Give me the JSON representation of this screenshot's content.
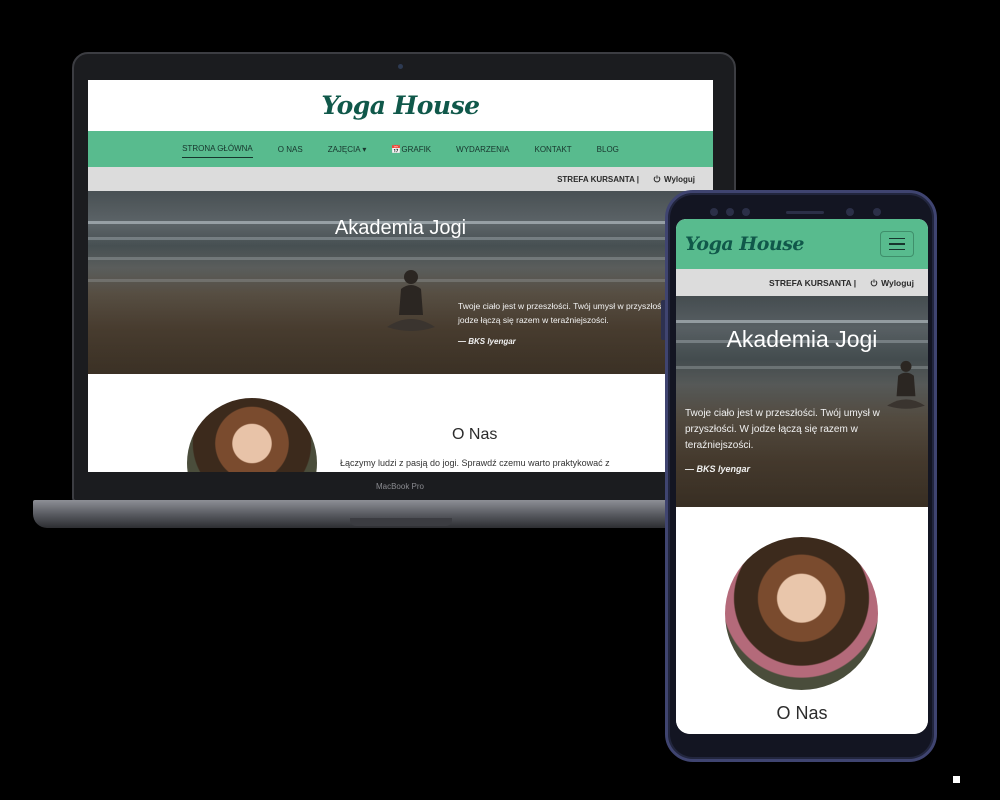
{
  "site": {
    "logo": "Yoga House",
    "nav": [
      "STRONA GŁÓWNA",
      "O NAS",
      "ZAJĘCIA ▾",
      "GRAFIK",
      "WYDARZENIA",
      "KONTAKT",
      "BLOG"
    ],
    "strefa": "STREFA KURSANTA |",
    "logout": "Wyloguj",
    "hero_title": "Akademia Jogi",
    "hero_quote_laptop_line1": "Twoje ciało jest w przeszłości. Twój umysł w przyszłoś",
    "hero_quote_laptop_line2": "jodze łączą się razem w teraźniejszości.",
    "hero_quote_phone": "Twoje ciało jest w przeszłości. Twój umysł w przyszłości. W jodze łączą się razem w teraźniejszości.",
    "hero_author": "— BKS Iyengar",
    "about_title": "O Nas",
    "about_text": "Łączymy ludzi z pasją do jogi. Sprawdź czemu warto praktykować z"
  },
  "device": {
    "laptop_brand": "MacBook Pro"
  },
  "colors": {
    "nav_green": "#58bb8e",
    "logo_green": "#10584a",
    "strefa_gray": "#dcdcdc"
  },
  "icons": {
    "calendar": "calendar-icon",
    "power": "power-icon",
    "menu": "hamburger-menu-icon"
  }
}
